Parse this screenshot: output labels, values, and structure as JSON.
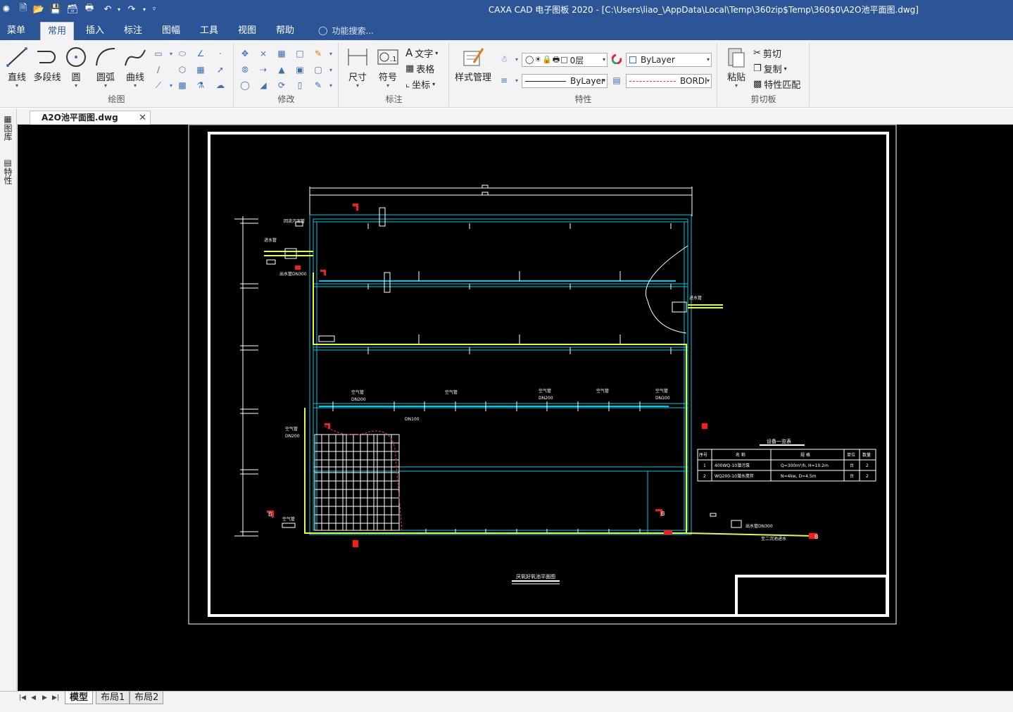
{
  "title_bar": {
    "title": "CAXA CAD 电子图板 2020 - [C:\\Users\\liao_\\AppData\\Local\\Temp\\360zip$Temp\\360$0\\A2O池平面图.dwg]"
  },
  "menu": {
    "tabs": [
      "菜单",
      "常用",
      "插入",
      "标注",
      "图幅",
      "工具",
      "视图",
      "帮助"
    ],
    "active": "常用",
    "search_placeholder": "功能搜索..."
  },
  "ribbon": {
    "draw": {
      "label": "绘图",
      "line": "直线",
      "polyline": "多段线",
      "circle": "圆",
      "arc": "圆弧",
      "spline": "曲线"
    },
    "modify": {
      "label": "修改"
    },
    "annotate": {
      "label": "标注",
      "dimension": "尺寸",
      "symbol": "符号",
      "text": "文字",
      "table": "表格",
      "coordinate": "坐标"
    },
    "properties": {
      "label": "特性",
      "style_manager": "样式管理",
      "layer_value": "0层",
      "color_value": "ByLayer",
      "linetype_value": "ByLayer",
      "lineweight_value": "BORDI"
    },
    "clipboard": {
      "label": "剪切板",
      "paste": "粘贴",
      "cut": "剪切",
      "copy": "复制",
      "match_props": "特性匹配"
    }
  },
  "document": {
    "tab_name": "A2O池平面图.dwg"
  },
  "side_panel": {
    "library": "图库",
    "properties": "特性"
  },
  "drawing": {
    "drawing_title": "厌氧好氧池平面图",
    "table_title": "设备一览表",
    "table_header": [
      "序号",
      "名 称",
      "规 格",
      "单位",
      "数量"
    ],
    "table_rows": [
      [
        "1",
        "400WQ-10潜污泵",
        "Q=300m³/h, H=10.2m",
        "台",
        "2"
      ],
      [
        "2",
        "WQ200-10潜水搅拌",
        "N=4kw, D=4.5m",
        "台",
        "2"
      ]
    ],
    "air_pipe": "空气管",
    "air_pipe_dn": "DN200",
    "air_pipe_dn_small": "DN100",
    "inlet_pipe": "进水管",
    "outflow_pipe": "出水管DN300",
    "sludge_pipe": "回流污泥管",
    "drain_pipe": "至二沉池进水",
    "section_mark": "B"
  },
  "layout_tabs": {
    "tabs": [
      "模型",
      "布局1",
      "布局2"
    ],
    "active": "模型"
  },
  "colors": {
    "titlebar": "#2c5597",
    "ribbon": "#f3f3f3",
    "canvas": "#000000",
    "cyan_line": "#00c8e6",
    "yellow_line": "#d8ff3a",
    "red_mark": "#ff1a1a"
  }
}
